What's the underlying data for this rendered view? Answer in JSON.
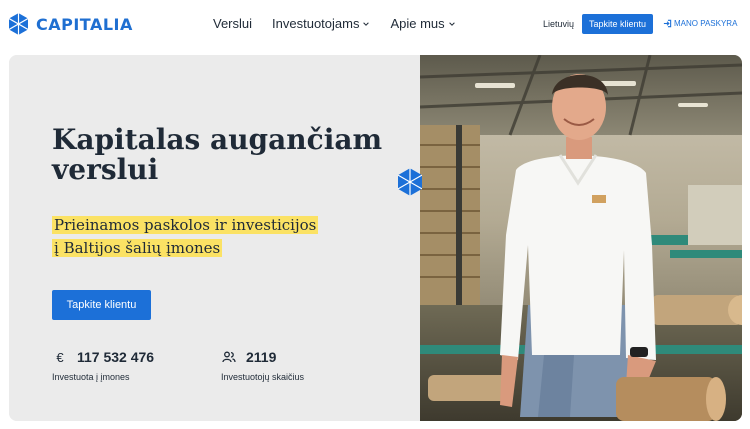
{
  "brand": {
    "name": "CAPITALIA",
    "accent": "#1c70d8",
    "logo_icon": "capitalia-hex-logo-icon"
  },
  "nav": {
    "items": [
      {
        "label": "Verslui",
        "has_dropdown": false
      },
      {
        "label": "Investuotojams",
        "has_dropdown": true
      },
      {
        "label": "Apie mus",
        "has_dropdown": true
      }
    ]
  },
  "header": {
    "language": "Lietuvių",
    "cta_label": "Tapkite klientu",
    "account_label": "MANO PASKYRA",
    "account_icon": "sign-in-icon"
  },
  "hero": {
    "title": "Kapitalas augančiam verslui",
    "subtitle_line1": "Prieinamos paskolos ir investicijos",
    "subtitle_line2": "į Baltijos šalių įmones",
    "highlight_color": "#fbe264",
    "cta_label": "Tapkite klientu",
    "stats": [
      {
        "icon": "euro-icon",
        "value": "117 532 476",
        "label": "Investuota į įmones"
      },
      {
        "icon": "users-icon",
        "value": "2119",
        "label": "Investuotojų skaičius"
      }
    ],
    "photo": "man-in-white-polo-at-sawmill-photo"
  }
}
